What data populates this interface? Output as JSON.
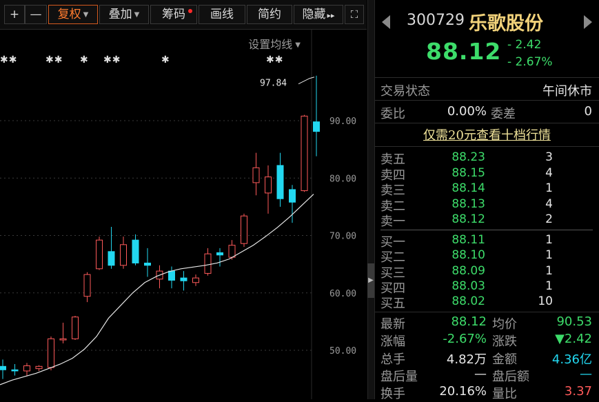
{
  "toolbar": {
    "zoom_in": "+",
    "zoom_out": "—",
    "fuquan": "复权",
    "overlay": "叠加",
    "chips": "筹码",
    "draw": "画线",
    "simple": "简约",
    "hide": "隐藏",
    "hide_arrows": "▸▸",
    "fullscreen": "⛶"
  },
  "chart": {
    "ma_settings": "设置均线",
    "peak_label": "97.84",
    "event_marks": [
      "✱✱",
      "✱✱",
      "✱",
      "✱✱",
      "✱",
      "✱✱"
    ],
    "y_ticks": [
      "90.00",
      "80.00",
      "70.00",
      "60.00",
      "50.00"
    ],
    "colors": {
      "up": "#ff5a5a",
      "down": "#22d7f0",
      "ma": "#e8e8e8",
      "grid": "#3a3a3a"
    }
  },
  "chart_data": {
    "type": "candlestick",
    "y_ticks": [
      90,
      80,
      70,
      60,
      50
    ],
    "ylim": [
      43,
      100
    ],
    "annotation": {
      "text": "97.84",
      "value": 97.84
    },
    "candles": [
      {
        "o": 47.2,
        "h": 48.4,
        "l": 45.0,
        "c": 46.6
      },
      {
        "o": 46.6,
        "h": 47.6,
        "l": 45.6,
        "c": 46.4
      },
      {
        "o": 46.4,
        "h": 47.8,
        "l": 45.6,
        "c": 47.3
      },
      {
        "o": 46.8,
        "h": 47.4,
        "l": 46.4,
        "c": 47.2
      },
      {
        "o": 47.0,
        "h": 52.4,
        "l": 46.5,
        "c": 52.0
      },
      {
        "o": 51.8,
        "h": 54.8,
        "l": 51.2,
        "c": 52.0
      },
      {
        "o": 52.0,
        "h": 56.0,
        "l": 51.8,
        "c": 55.8
      },
      {
        "o": 59.4,
        "h": 63.6,
        "l": 58.4,
        "c": 63.2
      },
      {
        "o": 64.2,
        "h": 69.8,
        "l": 64.0,
        "c": 69.2
      },
      {
        "o": 67.2,
        "h": 71.5,
        "l": 64.2,
        "c": 64.8
      },
      {
        "o": 64.8,
        "h": 69.8,
        "l": 64.2,
        "c": 68.4
      },
      {
        "o": 69.2,
        "h": 70.2,
        "l": 64.8,
        "c": 65.2
      },
      {
        "o": 65.2,
        "h": 67.8,
        "l": 62.8,
        "c": 64.8
      },
      {
        "o": 62.4,
        "h": 64.8,
        "l": 60.8,
        "c": 63.8
      },
      {
        "o": 63.8,
        "h": 64.6,
        "l": 60.8,
        "c": 62.2
      },
      {
        "o": 62.6,
        "h": 63.8,
        "l": 60.4,
        "c": 62.1
      },
      {
        "o": 61.8,
        "h": 63.2,
        "l": 61.2,
        "c": 62.6
      },
      {
        "o": 63.4,
        "h": 67.8,
        "l": 63.0,
        "c": 66.8
      },
      {
        "o": 67.0,
        "h": 67.8,
        "l": 64.6,
        "c": 66.6
      },
      {
        "o": 66.2,
        "h": 69.2,
        "l": 65.8,
        "c": 68.3
      },
      {
        "o": 68.6,
        "h": 73.8,
        "l": 68.0,
        "c": 73.4
      },
      {
        "o": 79.2,
        "h": 84.4,
        "l": 77.0,
        "c": 81.8
      },
      {
        "o": 77.4,
        "h": 82.2,
        "l": 73.8,
        "c": 80.2
      },
      {
        "o": 82.2,
        "h": 84.4,
        "l": 75.0,
        "c": 76.4
      },
      {
        "o": 78.0,
        "h": 78.8,
        "l": 72.2,
        "c": 75.8
      },
      {
        "o": 77.8,
        "h": 91.0,
        "l": 77.6,
        "c": 90.8
      },
      {
        "o": 89.8,
        "h": 97.84,
        "l": 83.8,
        "c": 88.12
      }
    ],
    "ma": [
      44.0,
      44.8,
      45.4,
      46.0,
      46.8,
      47.6,
      48.6,
      50.2,
      52.4,
      55.6,
      57.8,
      60.0,
      61.8,
      62.9,
      63.7,
      64.2,
      64.5,
      64.8,
      65.2,
      65.9,
      67.1,
      68.3,
      69.8,
      71.4,
      73.2,
      75.2,
      77.2
    ]
  },
  "quote": {
    "code": "300729",
    "name": "乐歌股份",
    "price": "88.12",
    "change": "- 2.42",
    "change_pct": "- 2.67%",
    "trade_status_label": "交易状态",
    "trade_status_value": "午间休市",
    "weibi_label": "委比",
    "weibi_value": "0.00%",
    "weicha_label": "委差",
    "weicha_value": "0",
    "promo": "仅需20元查看十档行情",
    "asks": [
      {
        "label": "卖五",
        "price": "88.23",
        "vol": "3"
      },
      {
        "label": "卖四",
        "price": "88.15",
        "vol": "4"
      },
      {
        "label": "卖三",
        "price": "88.14",
        "vol": "1"
      },
      {
        "label": "卖二",
        "price": "88.13",
        "vol": "4"
      },
      {
        "label": "卖一",
        "price": "88.12",
        "vol": "2"
      }
    ],
    "bids": [
      {
        "label": "买一",
        "price": "88.11",
        "vol": "1"
      },
      {
        "label": "买二",
        "price": "88.10",
        "vol": "1"
      },
      {
        "label": "买三",
        "price": "88.09",
        "vol": "1"
      },
      {
        "label": "买四",
        "price": "88.03",
        "vol": "1"
      },
      {
        "label": "买五",
        "price": "88.02",
        "vol": "10"
      }
    ],
    "stats": {
      "latest_label": "最新",
      "latest": "88.12",
      "avg_label": "均价",
      "avg": "90.53",
      "chgpct_label": "涨幅",
      "chgpct": "-2.67%",
      "chg_label": "涨跌",
      "chg": "▼2.42",
      "vol_label": "总手",
      "vol": "4.82万",
      "amount_label": "金额",
      "amount": "4.36亿",
      "ah_vol_label": "盘后量",
      "ah_vol": "—",
      "ah_amt_label": "盘后额",
      "ah_amt": "—",
      "turnover_label": "换手",
      "turnover": "20.16%",
      "volratio_label": "量比",
      "volratio": "3.37"
    }
  }
}
